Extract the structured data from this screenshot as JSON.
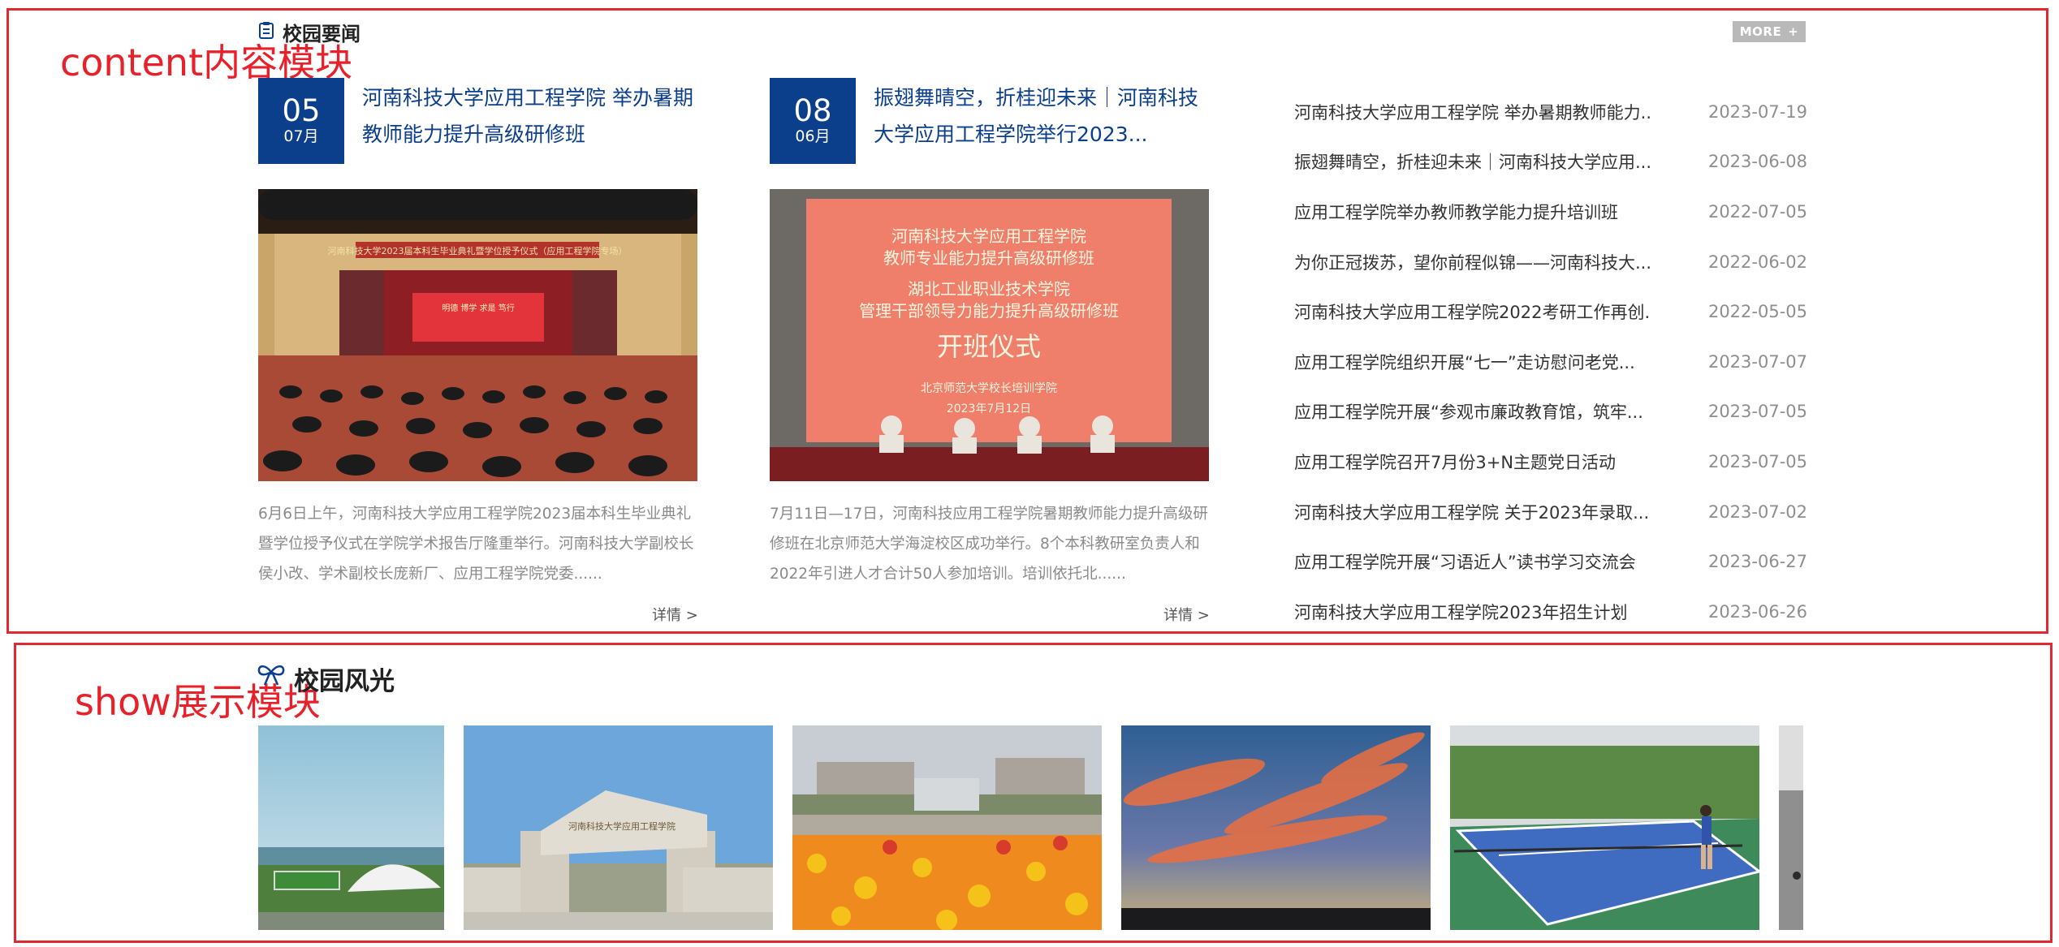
{
  "annotations": {
    "content_label": "content内容模块",
    "show_label": "show展示模块"
  },
  "news_section": {
    "title": "校园要闻",
    "more_label": "MORE",
    "more_icon": "plus-icon"
  },
  "featured": [
    {
      "day": "05",
      "month": "07月",
      "title": "河南科技大学应用工程学院 举办暑期教师能力提升高级研修班",
      "photo_banner": "河南科技大学2023届本科生毕业典礼暨学位授予仪式（应用工程学院专场）",
      "stage_text": "明德   博学   求是   笃行",
      "summary": "6月6日上午，河南科技大学应用工程学院2023届本科生毕业典礼暨学位授予仪式在学院学术报告厅隆重举行。河南科技大学副校长侯小改、学术副校长庞新厂、应用工程学院党委......",
      "detail": "详情 >"
    },
    {
      "day": "08",
      "month": "06月",
      "title": "振翅舞晴空，折桂迎未来｜河南科技大学应用工程学院举行2023...",
      "screen_lines": [
        "河南科技大学应用工程学院",
        "教师专业能力提升高级研修班",
        "湖北工业职业技术学院",
        "管理干部领导力能力提升高级研修班",
        "开班仪式",
        "北京师范大学校长培训学院",
        "2023年7月12日"
      ],
      "summary": "7月11日—17日，河南科技应用工程学院暑期教师能力提升高级研修班在北京师范大学海淀校区成功举行。8个本科教研室负责人和2022年引进人才合计50人参加培训。培训依托北......",
      "detail": "详情 >"
    }
  ],
  "news_list": [
    {
      "title": "河南科技大学应用工程学院 举办暑期教师能力...",
      "date": "2023-07-19"
    },
    {
      "title": "振翅舞晴空，折桂迎未来｜河南科技大学应用...",
      "date": "2023-06-08"
    },
    {
      "title": "应用工程学院举办教师教学能力提升培训班",
      "date": "2022-07-05"
    },
    {
      "title": "为你正冠拨苏，望你前程似锦——河南科技大...",
      "date": "2022-06-02"
    },
    {
      "title": "河南科技大学应用工程学院2022考研工作再创...",
      "date": "2022-05-05"
    },
    {
      "title": "应用工程学院组织开展“七一”走访慰问老党...",
      "date": "2023-07-07"
    },
    {
      "title": "应用工程学院开展“参观市廉政教育馆，筑牢...",
      "date": "2023-07-05"
    },
    {
      "title": "应用工程学院召开7月份3+N主题党日活动",
      "date": "2023-07-05"
    },
    {
      "title": "河南科技大学应用工程学院 关于2023年录取...",
      "date": "2023-07-02"
    },
    {
      "title": "应用工程学院开展“习语近人”读书学习交流会",
      "date": "2023-06-27"
    },
    {
      "title": "河南科技大学应用工程学院2023年招生计划",
      "date": "2023-06-26"
    }
  ],
  "show_section": {
    "title": "校园风光",
    "icon": "bow-icon",
    "gate_sign": "河南科技大学应用工程学院"
  },
  "colors": {
    "brand_blue": "#0b3f8c",
    "annotation_red": "#e8202a",
    "more_gray": "#b9b9b9",
    "muted_text": "#8a8a8a"
  }
}
